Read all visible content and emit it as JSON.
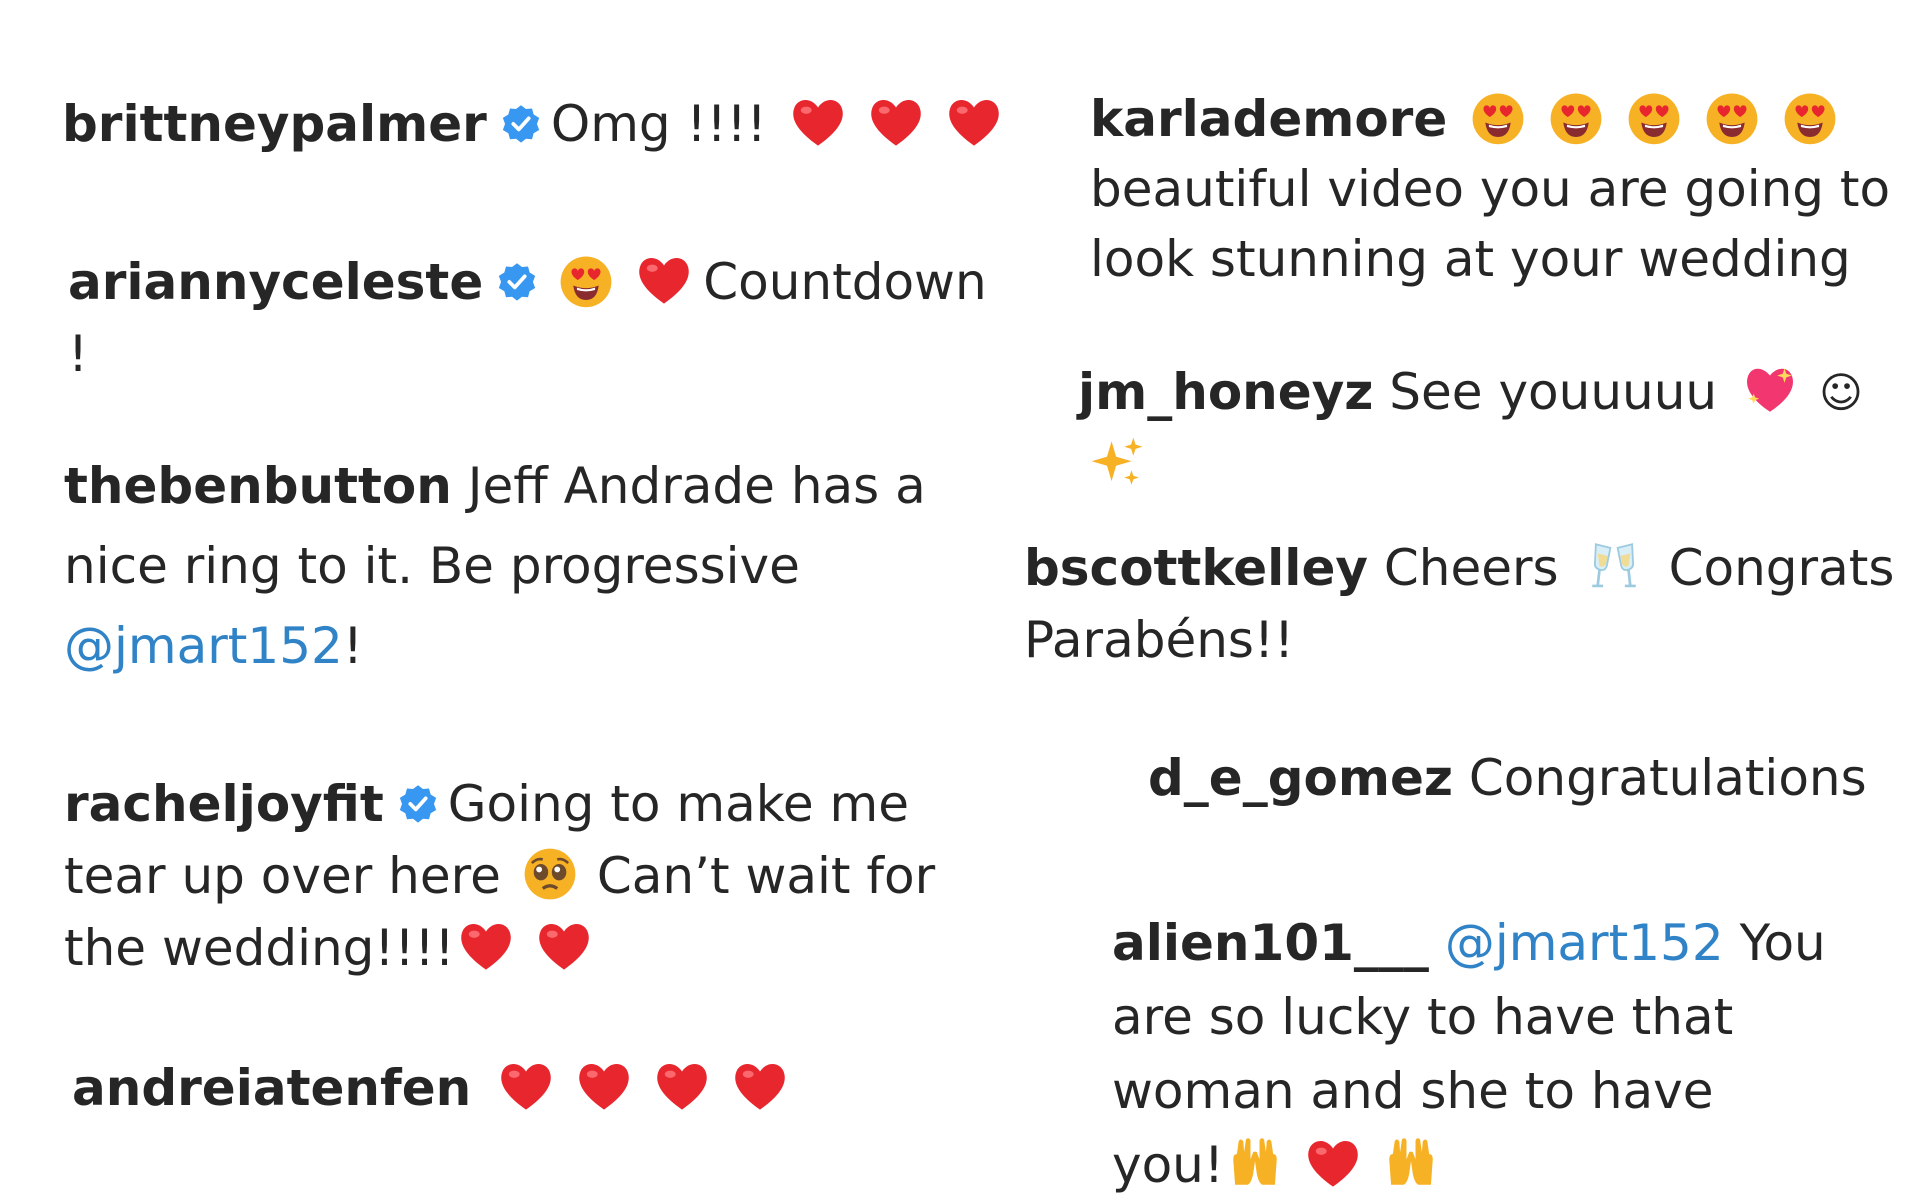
{
  "colors": {
    "text": "#262626",
    "mention": "#2f83c6",
    "verified_badge": "#3897f0",
    "heart": "#e8262e",
    "emoji_face": "#f7b125"
  },
  "comments": [
    {
      "username": "brittneypalmer",
      "verified": true,
      "text": "Omg !!!!",
      "emojis": [
        "red-heart",
        "red-heart",
        "red-heart"
      ]
    },
    {
      "username": "ariannyceleste",
      "verified": true,
      "emojis_before": [
        "heart-eyes-face",
        "red-heart"
      ],
      "text": "Countdown",
      "text_line2": "!"
    },
    {
      "username": "thebenbutton",
      "verified": false,
      "text": "Jeff Andrade has a",
      "text_line2": "nice ring to it. Be progressive",
      "mention": "@jmart152",
      "text_after_mention": "!"
    },
    {
      "username": "racheljoyfit",
      "verified": true,
      "text": "Going to make me",
      "text_line2": "tear up over here",
      "text_line2b": "Can’t wait for",
      "text_line3": "the wedding!!!!",
      "emojis": [
        "pleading-face",
        "red-heart",
        "red-heart"
      ]
    },
    {
      "username": "andreiatenfen",
      "verified": false,
      "emojis": [
        "red-heart",
        "red-heart",
        "red-heart",
        "red-heart"
      ]
    },
    {
      "username": "karlademore",
      "verified": false,
      "emojis": [
        "heart-eyes-face",
        "heart-eyes-face",
        "heart-eyes-face",
        "heart-eyes-face",
        "heart-eyes-face"
      ],
      "text_line2": "beautiful video you are going to",
      "text_line3": "look stunning at your wedding"
    },
    {
      "username": "jm_honeyz",
      "verified": false,
      "text": "See youuuuu",
      "emojis": [
        "sparkling-heart",
        "smiling-face",
        "sparkles"
      ],
      "smile_glyph": "☺"
    },
    {
      "username": "bscottkelley",
      "verified": false,
      "text": "Cheers",
      "text_after_emoji": "Congrats",
      "text_line2": "Parabéns!!",
      "emojis": [
        "clinking-glasses"
      ]
    },
    {
      "username": "d_e_gomez",
      "verified": false,
      "text": "Congratulations"
    },
    {
      "username": "alien101___",
      "verified": false,
      "mention": "@jmart152",
      "text": "You",
      "text_line2": "are so lucky to have that",
      "text_line3": "woman and she to have",
      "text_line4": "you!",
      "emojis": [
        "raising-hands",
        "red-heart",
        "raising-hands"
      ]
    }
  ]
}
